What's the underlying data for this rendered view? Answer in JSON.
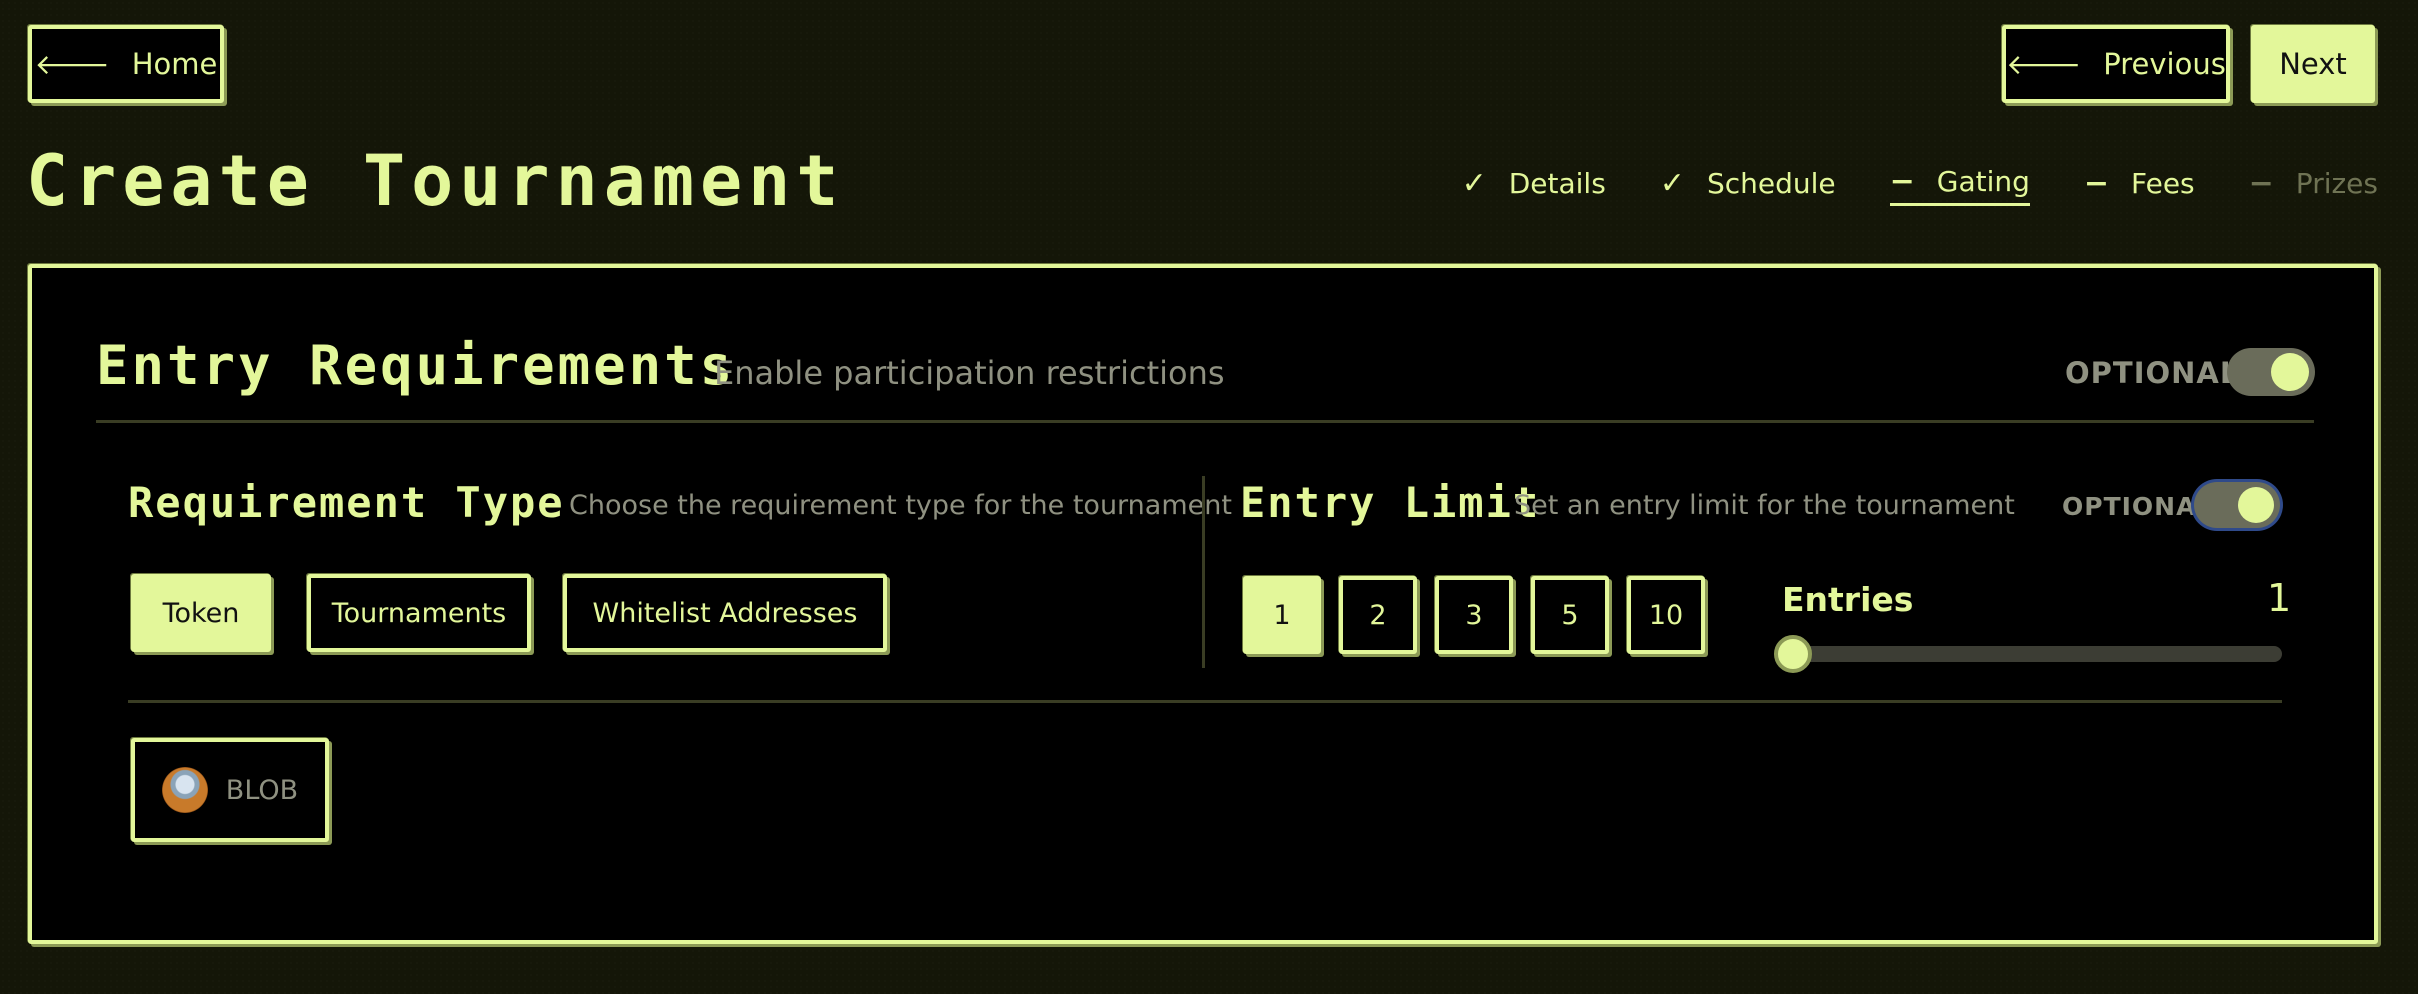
{
  "nav": {
    "home_label": "Home",
    "previous_label": "Previous",
    "next_label": "Next",
    "back_arrow": "🡐"
  },
  "page": {
    "title": "Create Tournament"
  },
  "stepper": {
    "steps": [
      {
        "label": "Details",
        "mark": "✓",
        "state": "done"
      },
      {
        "label": "Schedule",
        "mark": "✓",
        "state": "done"
      },
      {
        "label": "Gating",
        "mark": "−",
        "state": "active"
      },
      {
        "label": "Fees",
        "mark": "−",
        "state": "pending"
      },
      {
        "label": "Prizes",
        "mark": "−",
        "state": "disabled"
      }
    ]
  },
  "entry_requirements": {
    "title": "Entry Requirements",
    "subtitle": "Enable participation restrictions",
    "optional_label": "OPTIONAL",
    "enabled": true
  },
  "requirement_type": {
    "title": "Requirement Type",
    "subtitle": "Choose the requirement type for the tournament",
    "options": [
      "Token",
      "Tournaments",
      "Whitelist Addresses"
    ],
    "selected": "Token"
  },
  "entry_limit": {
    "title": "Entry Limit",
    "subtitle": "Set an entry limit for the tournament",
    "optional_label": "OPTIONAL",
    "enabled": true,
    "presets": [
      "1",
      "2",
      "3",
      "5",
      "10"
    ],
    "selected": "1",
    "entries_label": "Entries",
    "entries_value": "1",
    "slider_fraction": 0
  },
  "token": {
    "symbol": "BLOB",
    "icon": "blob-token-avatar"
  },
  "colors": {
    "accent": "#e3f79a",
    "background": "#141608",
    "panel": "#000000",
    "muted": "#8f9181"
  }
}
